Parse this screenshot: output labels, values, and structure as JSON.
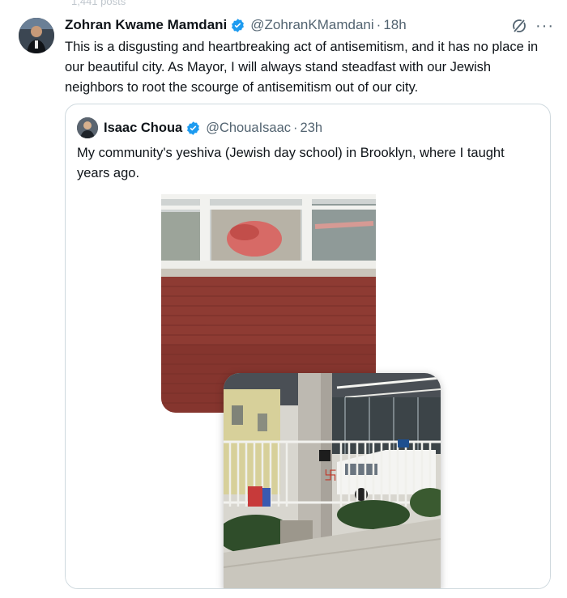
{
  "top_fade": "1,441 posts",
  "tweet": {
    "author_name": "Zohran Kwame Mamdani",
    "handle": "@ZohranKMamdani",
    "separator": "·",
    "time": "18h",
    "text": "This is a disgusting and heartbreaking act of antisemitism, and it has no place in our beautiful city. As Mayor, I will always stand steadfast with our Jewish neighbors to root the scourge of antisemitism out of our city.",
    "more_label": "···"
  },
  "quoted": {
    "author_name": "Isaac Choua",
    "handle": "@ChouaIsaac",
    "separator": "·",
    "time": "23h",
    "text": "My community's yeshiva (Jewish day school) in Brooklyn, where I taught years ago."
  },
  "icons": {
    "verified": "verified-badge-icon",
    "grok": "grok-icon",
    "more": "more-icon"
  },
  "colors": {
    "verified": "#1d9bf0",
    "secondary_text": "#536471",
    "border": "#cfd9de",
    "graffiti": "#c0392b"
  }
}
